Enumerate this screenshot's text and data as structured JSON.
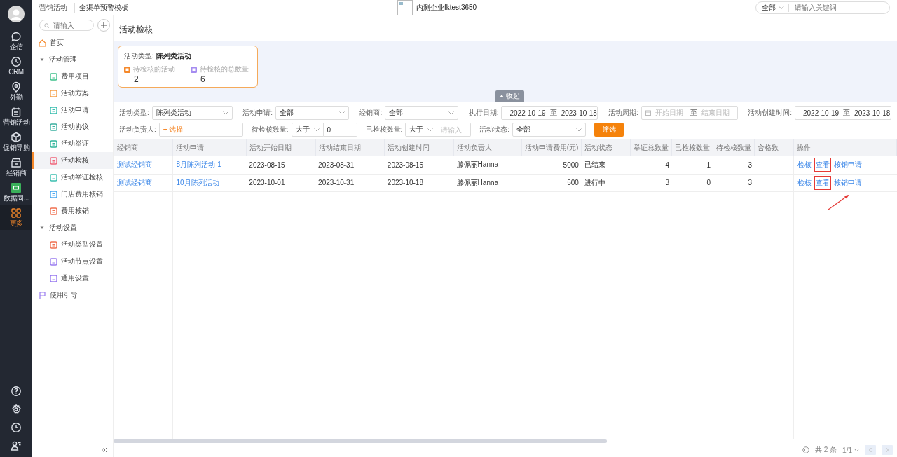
{
  "rail": {
    "items": [
      {
        "label": "企信",
        "selected": false
      },
      {
        "label": "CRM",
        "selected": false
      },
      {
        "label": "外勤",
        "selected": false
      },
      {
        "label": "营销活动",
        "selected": false
      },
      {
        "label": "促销导购",
        "selected": false
      },
      {
        "label": "经销商",
        "selected": false
      },
      {
        "label": "数据同...",
        "selected": false
      },
      {
        "label": "更多",
        "selected": true
      }
    ]
  },
  "top_bar": {
    "app_title": "营销活动",
    "template": "全渠单预警模板",
    "company": "内测企业fktest3650",
    "search_scope": "全部",
    "search_placeholder": "请输入关键词"
  },
  "sidebar": {
    "search_placeholder": "请输入",
    "items": [
      {
        "label": "首页",
        "selected": false
      },
      {
        "label": "活动管理",
        "expanded": true,
        "children": [
          {
            "label": "费用项目",
            "selected": false
          },
          {
            "label": "活动方案",
            "selected": false
          },
          {
            "label": "活动申请",
            "selected": false
          },
          {
            "label": "活动协议",
            "selected": false
          },
          {
            "label": "活动举证",
            "selected": false
          },
          {
            "label": "活动检核",
            "selected": true
          },
          {
            "label": "活动举证检核",
            "selected": false
          },
          {
            "label": "门店费用核销",
            "selected": false
          },
          {
            "label": "费用核销",
            "selected": false
          }
        ]
      },
      {
        "label": "活动设置",
        "expanded": true,
        "children": [
          {
            "label": "活动类型设置",
            "selected": false
          },
          {
            "label": "活动节点设置",
            "selected": false
          },
          {
            "label": "通用设置",
            "selected": false
          }
        ]
      },
      {
        "label": "使用引导",
        "selected": false
      }
    ]
  },
  "page_title": "活动检核",
  "summary": {
    "type_label": "活动类型:",
    "type_value": "陈列类活动",
    "stats": [
      {
        "label": "待检核的活动",
        "value": "2",
        "color": "#f5882a"
      },
      {
        "label": "待检核的总数量",
        "value": "6",
        "color": "#a58cf0"
      }
    ],
    "collapse_label": "收起"
  },
  "filters": [
    [
      {
        "kind": "select",
        "label": "活动类型:",
        "value": "陈列类活动"
      },
      {
        "kind": "select",
        "label": "活动申请:",
        "value": "全部"
      },
      {
        "kind": "select",
        "label": "经销商:",
        "value": "全部"
      },
      {
        "kind": "daterange",
        "label": "执行日期:",
        "start": "2022-10-19",
        "separator": "至",
        "end": "2023-10-18"
      },
      {
        "kind": "daterange",
        "label": "活动周期:",
        "start_placeholder": "开始日期",
        "separator": "至",
        "end_placeholder": "结束日期"
      },
      {
        "kind": "daterange",
        "label": "活动创建时间:",
        "start": "2022-10-19",
        "separator": "至",
        "end": "2023-10-18"
      }
    ],
    [
      {
        "kind": "picker",
        "label": "活动负责人:",
        "placeholder": "+ 选择"
      },
      {
        "kind": "compare",
        "label": "待检核数量:",
        "operator": "大于",
        "value": "0"
      },
      {
        "kind": "compare",
        "label": "已检核数量:",
        "operator": "大于",
        "placeholder": "请输入"
      },
      {
        "kind": "select",
        "label": "活动状态:",
        "value": "全部"
      },
      {
        "kind": "button",
        "label": "筛选"
      }
    ]
  ],
  "table": {
    "columns": [
      "经销商",
      "活动申请",
      "活动开始日期",
      "活动结束日期",
      "活动创建时间",
      "活动负责人",
      "活动申请费用(元)",
      "活动状态",
      "举证总数量",
      "已检核数量",
      "待检核数量",
      "合格数",
      "操作"
    ],
    "rows": [
      [
        {
          "kind": "link",
          "text": "测试经销商"
        },
        {
          "kind": "link",
          "text": "8月陈列活动-1"
        },
        {
          "kind": "text",
          "text": "2023-08-15"
        },
        {
          "kind": "text",
          "text": "2023-08-31"
        },
        {
          "kind": "text",
          "text": "2023-08-15"
        },
        {
          "kind": "text",
          "text": "滕佩丽Hanna"
        },
        {
          "kind": "number",
          "text": "5000"
        },
        {
          "kind": "text",
          "text": "已结束"
        },
        {
          "kind": "number",
          "text": "4"
        },
        {
          "kind": "number",
          "text": "1"
        },
        {
          "kind": "number",
          "text": "3"
        },
        {
          "kind": "text",
          "text": ""
        },
        {
          "kind": "actions",
          "actions": [
            {
              "label": "检核",
              "highlighted": false
            },
            {
              "label": "查看",
              "highlighted": true
            },
            {
              "label": "核销申请",
              "highlighted": false
            }
          ]
        }
      ],
      [
        {
          "kind": "link",
          "text": "测试经销商"
        },
        {
          "kind": "link",
          "text": "10月陈列活动"
        },
        {
          "kind": "text",
          "text": "2023-10-01"
        },
        {
          "kind": "text",
          "text": "2023-10-31"
        },
        {
          "kind": "text",
          "text": "2023-10-18"
        },
        {
          "kind": "text",
          "text": "滕佩丽Hanna"
        },
        {
          "kind": "number",
          "text": "500"
        },
        {
          "kind": "text",
          "text": "进行中"
        },
        {
          "kind": "number",
          "text": "3"
        },
        {
          "kind": "number",
          "text": "0"
        },
        {
          "kind": "number",
          "text": "3"
        },
        {
          "kind": "text",
          "text": ""
        },
        {
          "kind": "actions",
          "actions": [
            {
              "label": "检核",
              "highlighted": false
            },
            {
              "label": "查看",
              "highlighted": true
            },
            {
              "label": "核销申请",
              "highlighted": false
            }
          ]
        }
      ]
    ]
  },
  "pagination": {
    "total": "共 2 条",
    "page": "1/1"
  }
}
